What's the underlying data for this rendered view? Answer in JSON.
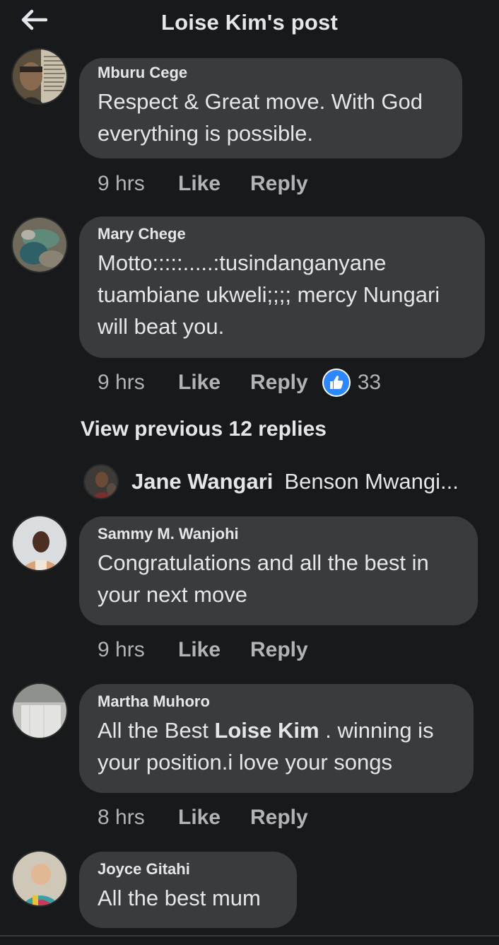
{
  "header": {
    "title": "Loise Kim's post"
  },
  "comments": [
    {
      "author": "Mburu Cege",
      "text": "Respect & Great move. With God everything is possible.",
      "time": "9 hrs",
      "like": "Like",
      "reply": "Reply"
    },
    {
      "author": "Mary Chege",
      "text": "Motto:::::.....:tusindanganyane tuambiane ukweli;;;; mercy Nungari will beat you.",
      "time": "9 hrs",
      "like": "Like",
      "reply": "Reply",
      "reaction_count": "33"
    },
    {
      "author": "Sammy M. Wanjohi",
      "text": "Congratulations and all the best in your next move",
      "time": "9 hrs",
      "like": "Like",
      "reply": "Reply"
    },
    {
      "author": "Martha Muhoro",
      "text_before": "All the Best",
      "mention": "Loise Kim",
      "text_after": ". winning is your position.i love your songs",
      "time": "8 hrs",
      "like": "Like",
      "reply": "Reply"
    },
    {
      "author": "Joyce Gitahi",
      "text": "All the best mum"
    }
  ],
  "view_replies": "View previous 12 replies",
  "reply_preview": {
    "name": "Jane Wangari",
    "text": "Benson Mwangi..."
  },
  "icons": {
    "back": "arrow-left-icon",
    "reaction": "thumbs-up-icon"
  },
  "colors": {
    "background": "#18191a",
    "bubble": "#3a3b3c",
    "muted_text": "#b0b3b8",
    "like_blue": "#2d88ff"
  }
}
